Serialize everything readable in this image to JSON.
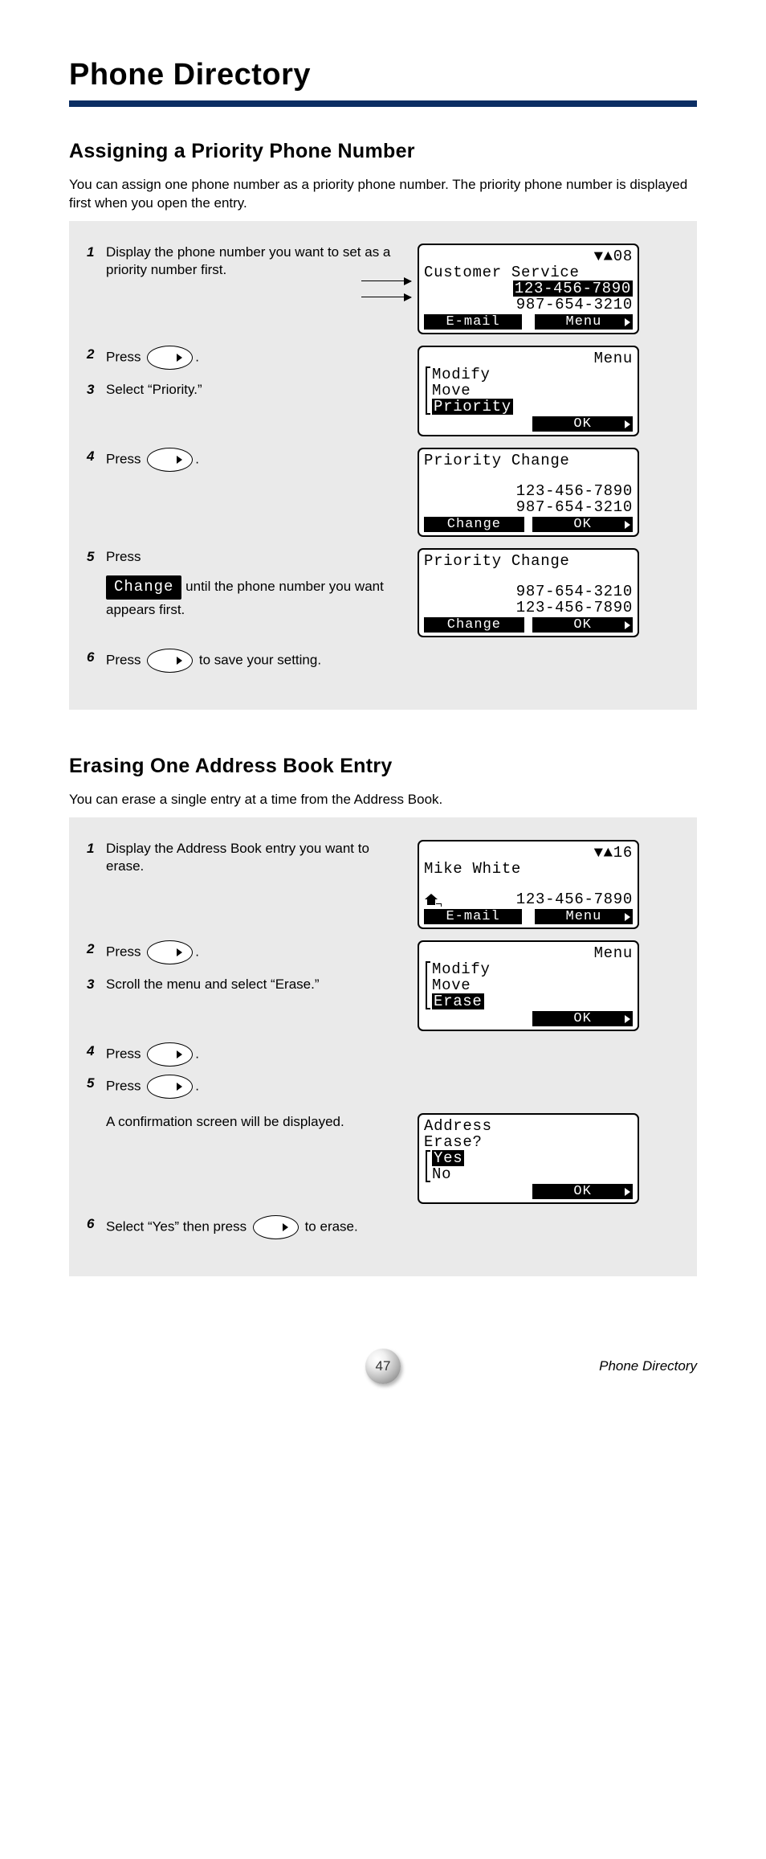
{
  "chapter_title": "Phone Directory",
  "section1": {
    "title": "Assigning a Priority Phone Number",
    "intro": "You can assign one phone number as a priority phone number. The priority phone number is displayed first when you open the entry.",
    "steps": [
      {
        "num": "1",
        "text_prefix": "Display the phone number you want to set as a priority number first.",
        "text_suffix": ""
      },
      {
        "num": "2",
        "text_prefix": "Press ",
        "btn": true,
        "text_suffix": "."
      },
      {
        "num": "3",
        "text_prefix": "Select “Priority.”",
        "text_suffix": ""
      },
      {
        "num": "4",
        "text_prefix": "Press ",
        "btn": true,
        "text_suffix": "."
      },
      {
        "num": "5",
        "text_prefix": "Press ",
        "change_pill": "Change",
        "text_suffix": " until the phone number you want appears first."
      },
      {
        "num": "6",
        "text_prefix": "Press ",
        "btn": true,
        "text_suffix": " to save your setting."
      }
    ],
    "lcd1": {
      "header": "▼▲08",
      "title": "Customer Service",
      "row_a": "123-456-7890",
      "row_b": "987-654-3210",
      "soft_left": "E-mail",
      "soft_right": "Menu"
    },
    "lcd2": {
      "header": "Menu",
      "items": [
        "Modify",
        "Move",
        "Priority"
      ],
      "soft_right": "OK"
    },
    "lcd3": {
      "title": "Priority Change",
      "row_a": "123-456-7890",
      "row_b": "987-654-3210",
      "soft_left": "Change",
      "soft_right": "OK"
    },
    "lcd4": {
      "title": "Priority Change",
      "row_a": "987-654-3210",
      "row_b": "123-456-7890",
      "soft_left": "Change",
      "soft_right": "OK"
    }
  },
  "section2": {
    "title": "Erasing One Address Book Entry",
    "intro": "You can erase a single entry at a time from the Address Book.",
    "steps": [
      {
        "num": "1",
        "text_prefix": "Display the Address Book entry you want to erase.",
        "text_suffix": ""
      },
      {
        "num": "2",
        "text_prefix": "Press ",
        "btn": true,
        "text_suffix": "."
      },
      {
        "num": "3",
        "text_prefix": "Scroll the menu and select “Erase.”",
        "text_suffix": ""
      },
      {
        "num": "4",
        "text_prefix": "Press ",
        "btn": true,
        "text_suffix": "."
      },
      {
        "num": "5",
        "text_prefix": "Press ",
        "btn": true,
        "text_suffix": "."
      },
      {
        "num": "",
        "text_prefix": "A confirmation screen will be displayed.",
        "text_suffix": ""
      },
      {
        "num": "6",
        "text_prefix": "Select “Yes” then press ",
        "btn": true,
        "text_suffix": " to erase."
      }
    ],
    "lcd1": {
      "header": "▼▲16",
      "title": "Mike White",
      "phone": "123-456-7890",
      "soft_left": "E-mail",
      "soft_right": "Menu"
    },
    "lcd2": {
      "header": "Menu",
      "items": [
        "Modify",
        "Move",
        "Erase"
      ],
      "soft_right": "OK"
    },
    "lcd3": {
      "row_a": "Address",
      "row_b": "Erase?",
      "opts": [
        "Yes",
        "No"
      ],
      "soft_right": "OK"
    }
  },
  "footer": {
    "page_num": "47",
    "label": "Phone Directory"
  }
}
